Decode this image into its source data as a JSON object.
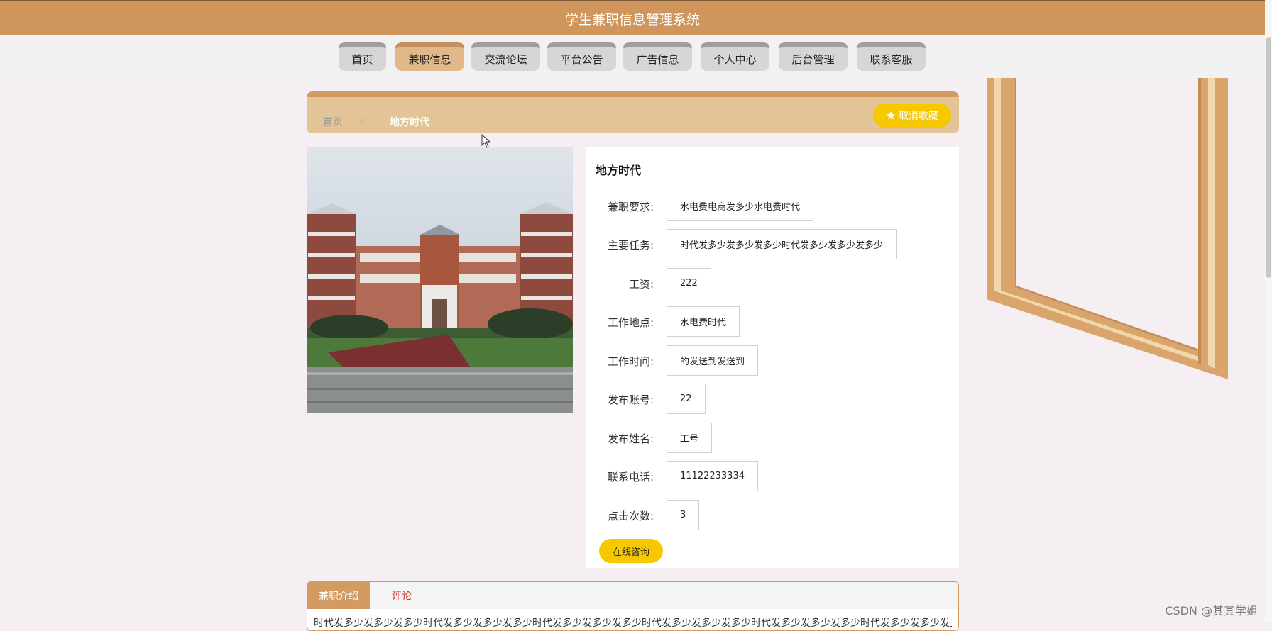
{
  "app": {
    "title": "学生兼职信息管理系统"
  },
  "nav": {
    "items": [
      {
        "label": "首页"
      },
      {
        "label": "兼职信息"
      },
      {
        "label": "交流论坛"
      },
      {
        "label": "平台公告"
      },
      {
        "label": "广告信息"
      },
      {
        "label": "个人中心"
      },
      {
        "label": "后台管理"
      },
      {
        "label": "联系客服"
      }
    ],
    "active_index": 1
  },
  "breadcrumb": {
    "home": "首页",
    "separator": "/",
    "current": "地方时代",
    "favorite_label": "取消收藏",
    "favorite_icon": "star-icon"
  },
  "detail": {
    "title": "地方时代",
    "image": "campus-building-photo",
    "fields": [
      {
        "label": "兼职要求:",
        "value": "水电费电商发多少水电费时代"
      },
      {
        "label": "主要任务:",
        "value": "时代发多少发多少发多少时代发多少发多少发多少"
      },
      {
        "label": "工资:",
        "value": "222"
      },
      {
        "label": "工作地点:",
        "value": "水电费时代"
      },
      {
        "label": "工作时间:",
        "value": "的发送到发送到"
      },
      {
        "label": "发布账号:",
        "value": "22"
      },
      {
        "label": "发布姓名:",
        "value": "工号"
      },
      {
        "label": "联系电话:",
        "value": "11122233334"
      },
      {
        "label": "点击次数:",
        "value": "3"
      }
    ],
    "consult_label": "在线咨询"
  },
  "tabs": {
    "intro_label": "兼职介绍",
    "comment_label": "评论",
    "intro_text": "时代发多少发多少发多少时代发多少发多少发多少时代发多少发多少发多少时代发多少发多少发多少时代发多少发多少发多少时代发多少发多少发多少时代发多少发多少发多少时代"
  },
  "watermark": "CSDN @其其学姐",
  "colors": {
    "brand": "#d0955a",
    "accent_yellow": "#f5c800",
    "breadcrumb_bg": "#e2c497",
    "nav_active": "#e2b888",
    "comment_tab": "#d0302a"
  }
}
